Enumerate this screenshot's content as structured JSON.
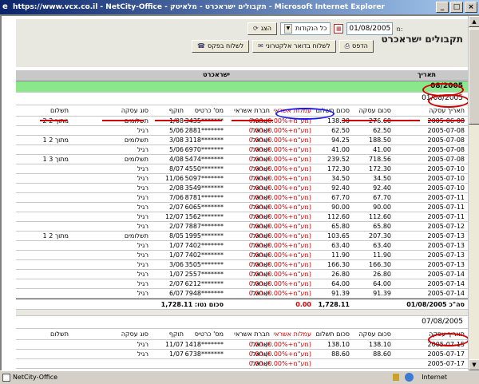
{
  "window": {
    "title": "https://www.vcx.co.il - NetCity-Office - תקבולים ישראכרט - מלאיטק - Microsoft Internet Explorer"
  },
  "toolbar": {
    "date_label": "מ:",
    "date_value": "01/08/2005",
    "company_select": "כל הנקודות",
    "show_label": "הצג",
    "print_label": "הדפס",
    "send_fax_label": "לשלוח בפקס",
    "send_email_label": "לשלוח בדואר אלקטרוני"
  },
  "page": {
    "title": "תקבולים ישראכרט"
  },
  "grid": {
    "date_header": "תאריך",
    "company_header": "ישראכרט",
    "month": "08/2005",
    "group1_date": "01/08/2005",
    "group2_date": "07/08/2005",
    "columns": {
      "txn_date": "תאריך עסקה",
      "amount": "סכום עסקה",
      "payment": "סכום תשלום",
      "fees": "עמלות אשראי",
      "card_company": "חברת אשראי",
      "card_no": "מס' כרטיס",
      "expiry": "תוקף",
      "txn_type": "סוג עסקה",
      "installments": "תשלום"
    },
    "rows": [
      {
        "date": "2005-06-08",
        "amount": "276.60",
        "pay": "138.30",
        "fee": "0.00 (0.00%+מע\"מ)",
        "co": "ישראל",
        "card": "3435*******",
        "exp": "1/08",
        "type": "תשלומים",
        "inst": "2 מתוך 2"
      },
      {
        "date": "2005-07-08",
        "amount": "62.50",
        "pay": "62.50",
        "fee": "0.00 (0.00%+מע\"מ)",
        "co": "ישראל",
        "card": "2881*******",
        "exp": "5/06",
        "type": "רגיל",
        "inst": ""
      },
      {
        "date": "2005-07-08",
        "amount": "188.50",
        "pay": "94.25",
        "fee": "0.00 (0.00%+מע\"מ)",
        "co": "ישראל",
        "card": "3118*******",
        "exp": "3/08",
        "type": "תשלומים",
        "inst": "1 מתוך 2"
      },
      {
        "date": "2005-07-08",
        "amount": "41.00",
        "pay": "41.00",
        "fee": "0.00 (0.00%+מע\"מ)",
        "co": "ישראל",
        "card": "6970*******",
        "exp": "5/06",
        "type": "רגיל",
        "inst": ""
      },
      {
        "date": "2005-07-08",
        "amount": "718.56",
        "pay": "239.52",
        "fee": "0.00 (0.00%+מע\"מ)",
        "co": "ישראל",
        "card": "5474*******",
        "exp": "4/08",
        "type": "תשלומים",
        "inst": "1 מתוך 3"
      },
      {
        "date": "2005-07-10",
        "amount": "172.30",
        "pay": "172.30",
        "fee": "0.00 (0.00%+מע\"מ)",
        "co": "ישראל",
        "card": "4550*******",
        "exp": "8/07",
        "type": "רגיל",
        "inst": ""
      },
      {
        "date": "2005-07-10",
        "amount": "34.50",
        "pay": "34.50",
        "fee": "0.00 (0.00%+מע\"מ)",
        "co": "ישראל",
        "card": "5097*******",
        "exp": "11/06",
        "type": "רגיל",
        "inst": ""
      },
      {
        "date": "2005-07-10",
        "amount": "92.40",
        "pay": "92.40",
        "fee": "0.00 (0.00%+מע\"מ)",
        "co": "ישראל",
        "card": "3549*******",
        "exp": "2/08",
        "type": "רגיל",
        "inst": ""
      },
      {
        "date": "2005-07-11",
        "amount": "67.70",
        "pay": "67.70",
        "fee": "0.00 (0.00%+מע\"מ)",
        "co": "ישראל",
        "card": "8781*******",
        "exp": "7/06",
        "type": "רגיל",
        "inst": ""
      },
      {
        "date": "2005-07-11",
        "amount": "90.00",
        "pay": "90.00",
        "fee": "0.00 (0.00%+מע\"מ)",
        "co": "ישראל",
        "card": "6065*******",
        "exp": "2/07",
        "type": "רגיל",
        "inst": ""
      },
      {
        "date": "2005-07-11",
        "amount": "112.60",
        "pay": "112.60",
        "fee": "0.00 (0.00%+מע\"מ)",
        "co": "ישראל",
        "card": "1562*******",
        "exp": "12/07",
        "type": "רגיל",
        "inst": ""
      },
      {
        "date": "2005-07-12",
        "amount": "65.80",
        "pay": "65.80",
        "fee": "0.00 (0.00%+מע\"מ)",
        "co": "ישראל",
        "card": "7887*******",
        "exp": "2/07",
        "type": "רגיל",
        "inst": ""
      },
      {
        "date": "2005-07-13",
        "amount": "207.30",
        "pay": "103.65",
        "fee": "0.00 (0.00%+מע\"מ)",
        "co": "ישראל",
        "card": "1995*******",
        "exp": "8/05",
        "type": "תשלומים",
        "inst": "1 מתוך 2"
      },
      {
        "date": "2005-07-13",
        "amount": "63.40",
        "pay": "63.40",
        "fee": "0.00 (0.00%+מע\"מ)",
        "co": "ישראל",
        "card": "7402*******",
        "exp": "1/07",
        "type": "רגיל",
        "inst": ""
      },
      {
        "date": "2005-07-13",
        "amount": "11.90",
        "pay": "11.90",
        "fee": "0.00 (0.00%+מע\"מ)",
        "co": "ישראל",
        "card": "7402*******",
        "exp": "1/07",
        "type": "רגיל",
        "inst": ""
      },
      {
        "date": "2005-07-13",
        "amount": "166.30",
        "pay": "166.30",
        "fee": "0.00 (0.00%+מע\"מ)",
        "co": "ישראל",
        "card": "3505*******",
        "exp": "3/06",
        "type": "רגיל",
        "inst": ""
      },
      {
        "date": "2005-07-14",
        "amount": "26.80",
        "pay": "26.80",
        "fee": "0.00 (0.00%+מע\"מ)",
        "co": "ישראל",
        "card": "2557*******",
        "exp": "1/07",
        "type": "רגיל",
        "inst": ""
      },
      {
        "date": "2005-07-14",
        "amount": "64.00",
        "pay": "64.00",
        "fee": "0.00 (0.00%+מע\"מ)",
        "co": "ישראל",
        "card": "6212*******",
        "exp": "2/07",
        "type": "רגיל",
        "inst": ""
      },
      {
        "date": "2005-07-14",
        "amount": "91.39",
        "pay": "91.39",
        "fee": "0.00 (0.00%+מע\"מ)",
        "co": "ישראל",
        "card": "7948*******",
        "exp": "6/07",
        "type": "רגיל",
        "inst": ""
      }
    ],
    "summary": {
      "label": "סה\"כ 01/08/2005",
      "payment": "1,728.11",
      "fees": "0.00",
      "net_label": "סכום נטו: 1,728.11"
    },
    "rows2": [
      {
        "date": "2005-07-15",
        "amount": "138.10",
        "pay": "138.10",
        "fee": "0.00 (0.00%+מע\"מ)",
        "co": "ישראל",
        "card": "1418*******",
        "exp": "11/07",
        "type": "רגיל",
        "inst": ""
      },
      {
        "date": "2005-07-17",
        "amount": "88.60",
        "pay": "88.60",
        "fee": "0.00 (0.00%+מע\"מ)",
        "co": "ישראל",
        "card": "6738*******",
        "exp": "1/07",
        "type": "רגיל",
        "inst": ""
      },
      {
        "date": "2005-07-17",
        "amount": "",
        "pay": "",
        "fee": "0.00 (0.00%+מע\"מ)",
        "co": "ישראל",
        "card": "",
        "exp": "",
        "type": "",
        "inst": ""
      }
    ]
  },
  "statusbar": {
    "left": "NetCity-Office",
    "zone": "Internet"
  },
  "colors": {
    "green_band": "#8ae88a",
    "fee_red": "#d00000",
    "annotation_red": "#d00000",
    "annotation_blue": "#1a1aee"
  }
}
